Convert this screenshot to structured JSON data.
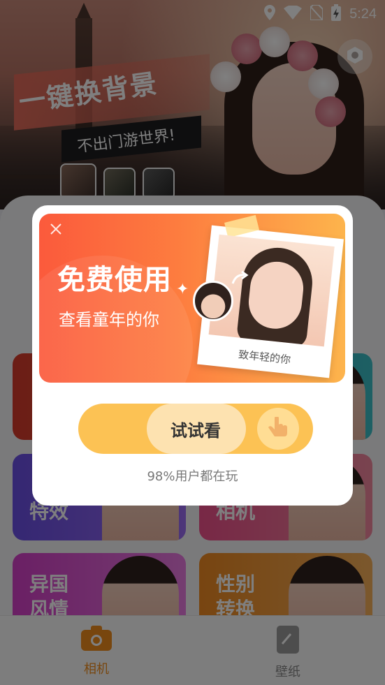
{
  "status_bar": {
    "time": "5:24",
    "icons": [
      "location-icon",
      "wifi-icon",
      "no-sim-icon",
      "battery-charging-icon"
    ]
  },
  "banner": {
    "headline": "一键换背景",
    "subline": "不出门游世界!",
    "thumbs": [
      "background-thumb-1",
      "background-thumb-2",
      "background-thumb-3"
    ]
  },
  "feature_cards": [
    {
      "label": "特效"
    },
    {
      "label": "相机"
    },
    {
      "label_line1": "异国",
      "label_line2": "风情"
    },
    {
      "label_line1": "性别",
      "label_line2": "转换"
    }
  ],
  "bottom_nav": [
    {
      "label": "相机",
      "icon": "camera-icon",
      "active": true,
      "color": "#f08c1c"
    },
    {
      "label": "壁纸",
      "icon": "wallpaper-icon",
      "active": false,
      "color": "#888888"
    }
  ],
  "dialog": {
    "title": "免费使用",
    "subtitle": "查看童年的你",
    "photo_caption": "致年轻的你",
    "button_label": "试试看",
    "footer": "98%用户都在玩"
  },
  "colors": {
    "accent": "#fcc254",
    "promo_start": "#fb5a3c",
    "promo_end": "#fdb44c"
  }
}
